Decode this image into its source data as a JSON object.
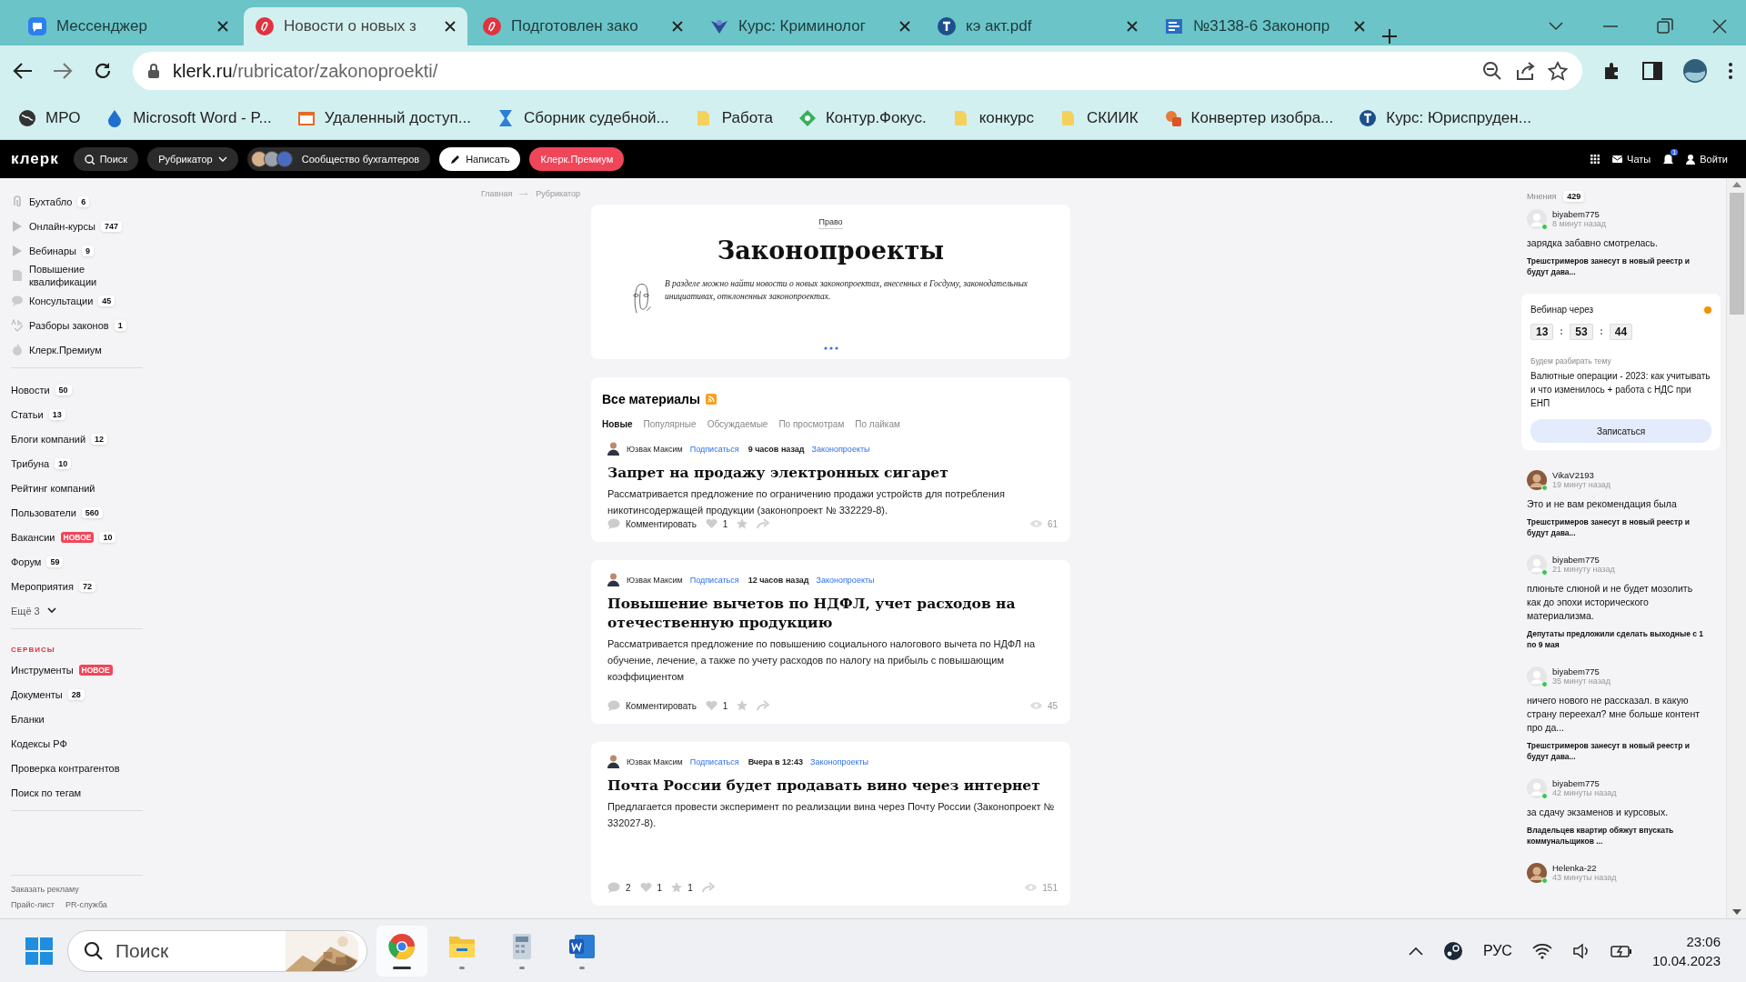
{
  "browser": {
    "tabs": [
      {
        "title": "Мессенджер",
        "selected": false
      },
      {
        "title": "Новости о новых з",
        "selected": true
      },
      {
        "title": "Подготовлен зако",
        "selected": false
      },
      {
        "title": "Курс: Криминолог",
        "selected": false
      },
      {
        "title": "кэ акт.pdf",
        "selected": false
      },
      {
        "title": "№3138-6 Законопр",
        "selected": false
      }
    ],
    "address": {
      "host": "klerk.ru",
      "path": "/rubricator/zakonoproekti/"
    },
    "bookmarks": [
      "МРО",
      "Microsoft Word - P...",
      "Удаленный доступ...",
      "Сборник судебной...",
      "Работа",
      "Контур.Фокус.",
      "конкурс",
      "СКИИК",
      "Конвертер изобра...",
      "Курс: Юриспруден..."
    ]
  },
  "site_header": {
    "logo": "клерк",
    "search": "Поиск",
    "rubricator": "Рубрикатор",
    "community": "Сообщество бухгалтеров",
    "write": "Написать",
    "premium": "Клерк.Премиум",
    "chats": "Чаты",
    "notifications": "1",
    "login": "Войти"
  },
  "sidebar": {
    "sections": [
      {
        "items": [
          {
            "label": "Бухтабло",
            "count": "6"
          },
          {
            "label": "Онлайн-курсы",
            "count": "747"
          },
          {
            "label": "Вебинары",
            "count": "9"
          },
          {
            "label": "Повышение квалификации"
          },
          {
            "label": "Консультации",
            "count": "45"
          },
          {
            "label": "Разборы законов",
            "count": "1"
          },
          {
            "label": "Клерк.Премиум"
          }
        ]
      },
      {
        "items": [
          {
            "label": "Новости",
            "count": "50"
          },
          {
            "label": "Статьи",
            "count": "13"
          },
          {
            "label": "Блоги компаний",
            "count": "12"
          },
          {
            "label": "Трибуна",
            "count": "10"
          },
          {
            "label": "Рейтинг компаний"
          },
          {
            "label": "Пользователи",
            "count": "560"
          },
          {
            "label": "Вакансии",
            "badge": "НОВОЕ",
            "count": "10"
          },
          {
            "label": "Форум",
            "count": "59"
          },
          {
            "label": "Мероприятия",
            "count": "72"
          }
        ],
        "more": "Ещё 3"
      },
      {
        "heading": "СЕРВИСЫ",
        "items": [
          {
            "label": "Инструменты",
            "badge": "НОВОЕ"
          },
          {
            "label": "Документы",
            "count": "28"
          },
          {
            "label": "Бланки"
          },
          {
            "label": "Кодексы РФ"
          },
          {
            "label": "Проверка контрагентов"
          },
          {
            "label": "Поиск по тегам"
          }
        ]
      }
    ],
    "footer": [
      "Заказать рекламу",
      "Прайс-лист",
      "PR-служба"
    ]
  },
  "breadcrumb": [
    "Главная",
    "Рубрикатор"
  ],
  "hero": {
    "category": "Право",
    "title": "Законопроекты",
    "description": "В разделе можно найти новости о новых законопроектах, внесенных в Госдуму, законодательных инициативах, отклоненных законопроектах."
  },
  "materials": {
    "title": "Все материалы",
    "sort_tabs": [
      {
        "label": "Новые",
        "selected": true
      },
      {
        "label": "Популярные",
        "selected": false
      },
      {
        "label": "Обсуждаемые",
        "selected": false
      },
      {
        "label": "По просмотрам",
        "selected": false
      },
      {
        "label": "По лайкам",
        "selected": false
      }
    ],
    "articles": [
      {
        "author": "Юзвак Максим",
        "subscribe": "Подписаться",
        "time": "9 часов назад",
        "rubric": "Законопроекты",
        "title": "Запрет на продажу электронных сигарет",
        "summary": "Рассматривается предложение по ограничению продажи устройств для потребления никотинсодержащей продукции (законопроект № 332229-8).",
        "comments": "Комментировать",
        "likes": "1",
        "views": "61"
      },
      {
        "author": "Юзвак Максим",
        "subscribe": "Подписаться",
        "time": "12 часов назад",
        "rubric": "Законопроекты",
        "title": "Повышение вычетов по НДФЛ, учет расходов на отечественную продукцию",
        "summary": "Рассматривается предложение по повышению социального налогового вычета по НДФЛ на обучение, лечение, а также по учету расходов по налогу на прибыль с повышающим коэффициентом",
        "comments": "Комментировать",
        "likes": "1",
        "views": "45"
      },
      {
        "author": "Юзвак Максим",
        "subscribe": "Подписаться",
        "time": "Вчера в 12:43",
        "rubric": "Законопроекты",
        "title": "Почта России будет продавать вино через интернет",
        "summary": "Предлагается провести эксперимент по реализации вина через Почту России (Законопроект № 332027-8).",
        "comments": "2",
        "likes": "1",
        "favorites": "1",
        "views": "151"
      }
    ]
  },
  "opinions": {
    "label": "Мнения",
    "count": "429",
    "feed": [
      {
        "kind": "comment",
        "photo_avatar": false,
        "user": "biyabem775",
        "time": "8 минут назад",
        "text": "зарядка забавно смотрелась.",
        "article": "Трешстримеров занесут в новый реестр и будут дава..."
      },
      {
        "kind": "webinar",
        "heading": "Вебинар через",
        "timer": [
          "13",
          "53",
          "44"
        ],
        "subheading": "Будем разбирать тему",
        "topic": "Валютные операции - 2023: как учитывать и что изменилось + работа с НДС при ЕНП",
        "button": "Записаться"
      },
      {
        "kind": "comment",
        "photo_avatar": true,
        "user": "VikaV2193",
        "time": "19 минут назад",
        "text": "Это и не вам рекомендация была",
        "article": "Трешстримеров занесут в новый реестр и будут дава..."
      },
      {
        "kind": "comment",
        "photo_avatar": false,
        "user": "biyabem775",
        "time": "21 минуту назад",
        "text": "плюньте слюной и не будет мозолить как до эпохи исторического материализма.",
        "article": "Депутаты предложили сделать выходные с 1 по 9 мая"
      },
      {
        "kind": "comment",
        "photo_avatar": false,
        "user": "biyabem775",
        "time": "35 минут назад",
        "text": "ничего нового не рассказал. в какую страну переехал? мне больше контент про да...",
        "article": "Трешстримеров занесут в новый реестр и будут дава..."
      },
      {
        "kind": "comment",
        "photo_avatar": false,
        "user": "biyabem775",
        "time": "42 минуты назад",
        "text": "за сдачу экзаменов и курсовых.",
        "article": "Владельцев квартир обяжут впускать коммунальщиков ..."
      },
      {
        "kind": "comment",
        "photo_avatar": true,
        "user": "Helenka-22",
        "time": "43 минуты назад"
      }
    ]
  },
  "taskbar": {
    "search": {
      "placeholder": "Поиск"
    },
    "apps": [
      {
        "selected": true
      },
      {
        "selected": false
      },
      {
        "selected": false
      },
      {
        "selected": false
      }
    ],
    "language": "РУС",
    "time": "23:06",
    "date": "10.04.2023"
  }
}
